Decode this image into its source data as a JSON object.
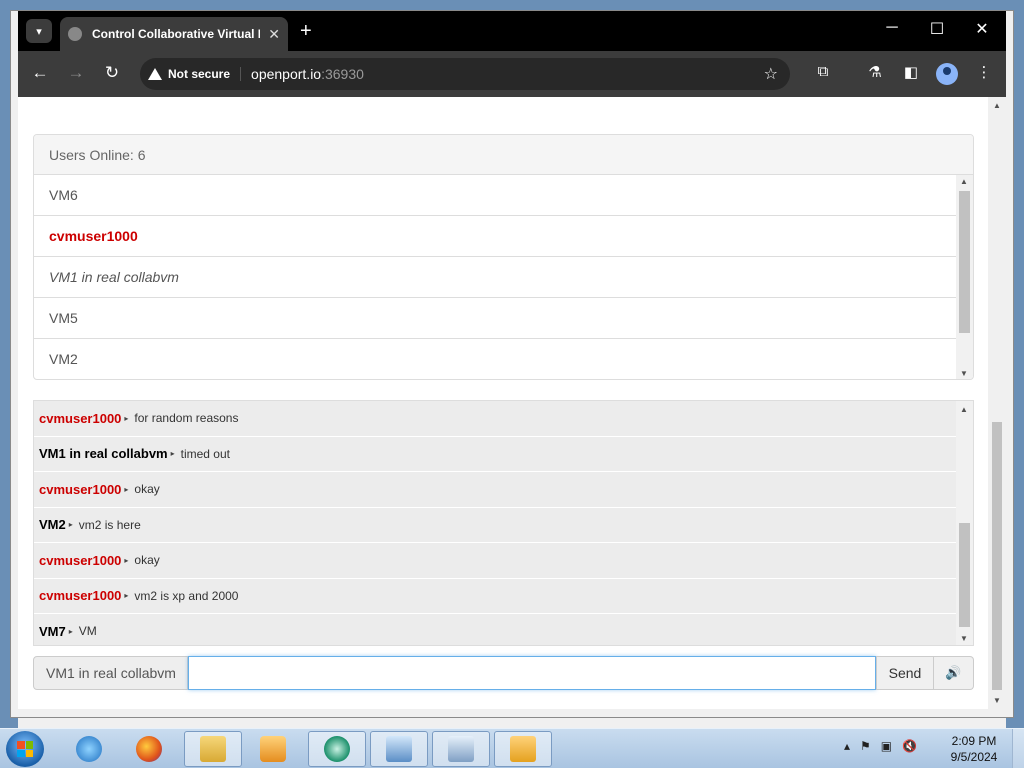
{
  "browser": {
    "tab_title": "Control Collaborative Virtual M",
    "new_tab_symbol": "+",
    "url_secure_label": "Not secure",
    "url_host": "openport.io",
    "url_port": ":36930"
  },
  "users": {
    "heading": "Users Online: 6",
    "items": [
      {
        "name": "VM6",
        "style": "normal"
      },
      {
        "name": "cvmuser1000",
        "style": "self"
      },
      {
        "name": "VM1 in real collabvm",
        "style": "italic"
      },
      {
        "name": "VM5",
        "style": "normal"
      },
      {
        "name": "VM2",
        "style": "normal"
      }
    ]
  },
  "chat": {
    "messages": [
      {
        "user": "cvmuser1000",
        "self": true,
        "text": "for random reasons"
      },
      {
        "user": "VM1 in real collabvm",
        "self": false,
        "text": "timed out"
      },
      {
        "user": "cvmuser1000",
        "self": true,
        "text": "okay"
      },
      {
        "user": "VM2",
        "self": false,
        "text": "vm2 is here"
      },
      {
        "user": "cvmuser1000",
        "self": true,
        "text": "okay"
      },
      {
        "user": "cvmuser1000",
        "self": true,
        "text": "vm2 is xp and 2000"
      },
      {
        "user": "VM7",
        "self": false,
        "text": "VM"
      }
    ],
    "separator": "▸"
  },
  "input": {
    "username": "VM1 in real collabvm",
    "value": "",
    "send_label": "Send",
    "volume_icon": "speaker-icon"
  },
  "taskbar": {
    "time": "2:09 PM",
    "date": "9/5/2024"
  },
  "colors": {
    "self_user": "#cc0000",
    "chrome_dark": "#3c3c3c"
  }
}
